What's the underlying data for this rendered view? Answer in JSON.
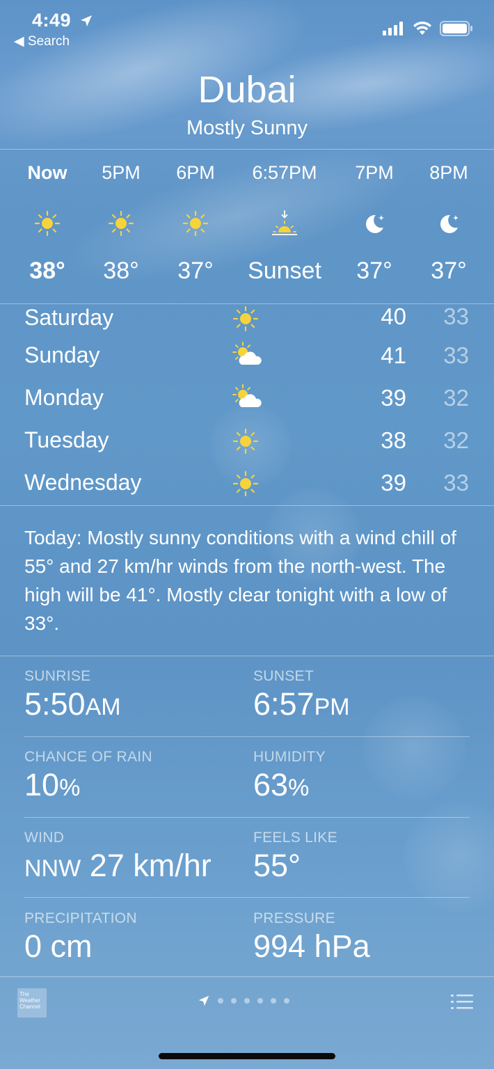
{
  "status_bar": {
    "time": "4:49",
    "back_label": "◀ Search"
  },
  "header": {
    "city": "Dubai",
    "condition": "Mostly Sunny"
  },
  "hourly": [
    {
      "label": "Now",
      "icon": "sun-icon",
      "temp": "38°"
    },
    {
      "label": "5PM",
      "icon": "sun-icon",
      "temp": "38°"
    },
    {
      "label": "6PM",
      "icon": "sun-icon",
      "temp": "37°"
    },
    {
      "label": "6:57PM",
      "icon": "sunset-icon",
      "temp": "Sunset"
    },
    {
      "label": "7PM",
      "icon": "moon-icon",
      "temp": "37°"
    },
    {
      "label": "8PM",
      "icon": "moon-icon",
      "temp": "37°"
    }
  ],
  "daily": [
    {
      "day": "Saturday",
      "icon": "sun-icon",
      "high": "40",
      "low": "33"
    },
    {
      "day": "Sunday",
      "icon": "partly-cloudy-icon",
      "high": "41",
      "low": "33"
    },
    {
      "day": "Monday",
      "icon": "partly-cloudy-icon",
      "high": "39",
      "low": "32"
    },
    {
      "day": "Tuesday",
      "icon": "sun-icon",
      "high": "38",
      "low": "32"
    },
    {
      "day": "Wednesday",
      "icon": "sun-icon",
      "high": "39",
      "low": "33"
    }
  ],
  "summary": "Today: Mostly sunny conditions with a wind chill of 55° and 27 km/hr winds from the north-west. The high will be 41°. Mostly clear tonight with a low of 33°.",
  "details": {
    "sunrise": {
      "label": "SUNRISE",
      "value": "5:50",
      "suffix": "AM"
    },
    "sunset": {
      "label": "SUNSET",
      "value": "6:57",
      "suffix": "PM"
    },
    "chance_of_rain": {
      "label": "CHANCE OF RAIN",
      "value": "10",
      "suffix": "%"
    },
    "humidity": {
      "label": "HUMIDITY",
      "value": "63",
      "suffix": "%"
    },
    "wind": {
      "label": "WIND",
      "prefix": "NNW",
      "value": "27 km/hr"
    },
    "feels_like": {
      "label": "FEELS LIKE",
      "value": "55°"
    },
    "precipitation": {
      "label": "PRECIPITATION",
      "value": "0 cm"
    },
    "pressure": {
      "label": "PRESSURE",
      "value": "994 hPa"
    }
  },
  "toolbar": {
    "logo_text": "The Weather Channel",
    "page_count": 6,
    "current_page_icon": "location-arrow-icon",
    "list_icon": "list-icon"
  },
  "colors": {
    "sun": "#f7d33b",
    "text": "#ffffff",
    "low_temp": "rgba(255,255,255,0.55)"
  }
}
